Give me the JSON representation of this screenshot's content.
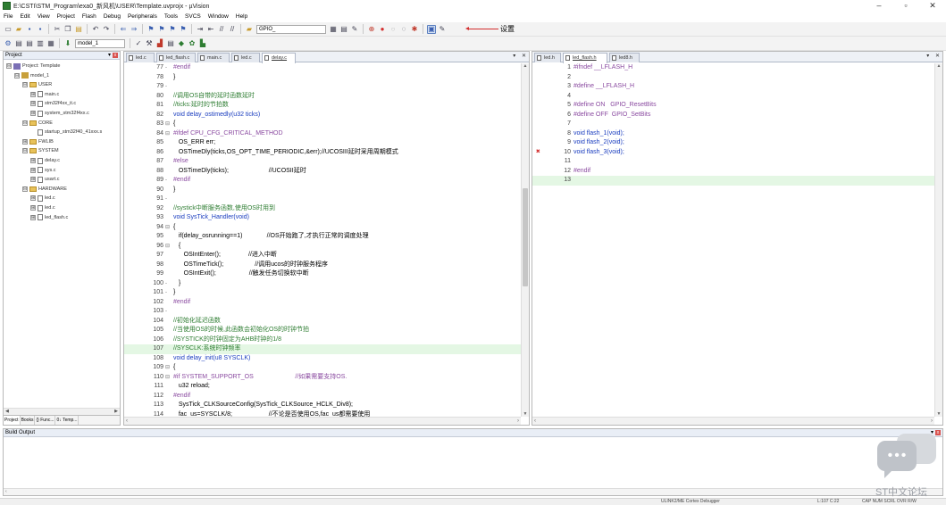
{
  "window": {
    "title": "E:\\CSTI\\STM_Program\\exa0_新风机\\USER\\Template.uvprojx - µVision",
    "controls": [
      "–",
      "▫",
      "✕"
    ]
  },
  "menu": [
    "File",
    "Edit",
    "View",
    "Project",
    "Flash",
    "Debug",
    "Peripherals",
    "Tools",
    "SVCS",
    "Window",
    "Help"
  ],
  "toolbar": {
    "search_combo": "GPIO_",
    "target_combo": "model_1",
    "annotation": "设置"
  },
  "project": {
    "title": "Project",
    "pin": "▾",
    "close": "x",
    "tree": [
      {
        "label": "Project: Template",
        "level": 0,
        "kind": "project",
        "exp": "⊟"
      },
      {
        "label": "model_1",
        "level": 1,
        "kind": "target",
        "exp": "⊟"
      },
      {
        "label": "USER",
        "level": 2,
        "kind": "folder",
        "exp": "⊟"
      },
      {
        "label": "main.c",
        "level": 3,
        "kind": "file",
        "exp": "⊞"
      },
      {
        "label": "stm32f4xx_it.c",
        "level": 3,
        "kind": "file",
        "exp": "⊞"
      },
      {
        "label": "system_stm32f4xx.c",
        "level": 3,
        "kind": "file",
        "exp": "⊞"
      },
      {
        "label": "CORE",
        "level": 2,
        "kind": "folder",
        "exp": "⊟"
      },
      {
        "label": "startup_stm32f40_41xxx.s",
        "level": 3,
        "kind": "file",
        "exp": ""
      },
      {
        "label": "FWLIB",
        "level": 2,
        "kind": "folder",
        "exp": "⊞"
      },
      {
        "label": "SYSTEM",
        "level": 2,
        "kind": "folder",
        "exp": "⊟"
      },
      {
        "label": "delay.c",
        "level": 3,
        "kind": "file",
        "exp": "⊞"
      },
      {
        "label": "sys.c",
        "level": 3,
        "kind": "file",
        "exp": "⊞"
      },
      {
        "label": "usart.c",
        "level": 3,
        "kind": "file",
        "exp": "⊞"
      },
      {
        "label": "HARDWARE",
        "level": 2,
        "kind": "folder",
        "exp": "⊟"
      },
      {
        "label": "led.c",
        "level": 3,
        "kind": "file",
        "exp": "⊞"
      },
      {
        "label": "led.c",
        "level": 3,
        "kind": "file",
        "exp": "⊞"
      },
      {
        "label": "led_flash.c",
        "level": 3,
        "kind": "file",
        "exp": "⊞"
      }
    ],
    "bottom_tabs": [
      "Project",
      "Books",
      "{} Func...",
      "0↓ Temp..."
    ]
  },
  "editor_left": {
    "tabs": [
      "led.c",
      "led_flash.c",
      "main.c",
      "led.c",
      "delay.c"
    ],
    "active_tab": 4,
    "lines": [
      {
        "n": "77",
        "f": "-",
        "t": "#endif",
        "c": "pp"
      },
      {
        "n": "78",
        "f": "",
        "t": "}",
        "c": ""
      },
      {
        "n": "79",
        "f": "-",
        "t": "",
        "c": ""
      },
      {
        "n": "80",
        "f": "",
        "t": "//调用OS自带的延时函数延时",
        "c": "cm"
      },
      {
        "n": "81",
        "f": "",
        "t": "//ticks:延时的节拍数",
        "c": "cm"
      },
      {
        "n": "82",
        "f": "",
        "t": "void delay_ostimedly(u32 ticks)",
        "c": "kw"
      },
      {
        "n": "83",
        "f": "⊟",
        "t": "{",
        "c": ""
      },
      {
        "n": "84",
        "f": "⊟",
        "t": "#ifdef CPU_CFG_CRITICAL_METHOD",
        "c": "pp"
      },
      {
        "n": "85",
        "f": "",
        "t": "   OS_ERR err;",
        "c": ""
      },
      {
        "n": "86",
        "f": "",
        "t": "   OSTimeDly(ticks,OS_OPT_TIME_PERIODIC,&err);//UCOSIII延时采用周期模式",
        "c": ""
      },
      {
        "n": "87",
        "f": "",
        "t": "#else",
        "c": "pp"
      },
      {
        "n": "88",
        "f": "",
        "t": "   OSTimeDly(ticks);                       //UCOSII延时",
        "c": ""
      },
      {
        "n": "89",
        "f": "-",
        "t": "#endif",
        "c": "pp"
      },
      {
        "n": "90",
        "f": "",
        "t": "}",
        "c": ""
      },
      {
        "n": "91",
        "f": "-",
        "t": "",
        "c": ""
      },
      {
        "n": "92",
        "f": "",
        "t": "//systick中断服务函数,使用OS时用到",
        "c": "cm"
      },
      {
        "n": "93",
        "f": "",
        "t": "void SysTick_Handler(void)",
        "c": "kw"
      },
      {
        "n": "94",
        "f": "⊟",
        "t": "{",
        "c": ""
      },
      {
        "n": "95",
        "f": "",
        "t": "   if(delay_osrunning==1)              //OS开始跑了,才执行正常的调度处理",
        "c": ""
      },
      {
        "n": "96",
        "f": "⊟",
        "t": "   {",
        "c": ""
      },
      {
        "n": "97",
        "f": "",
        "t": "      OSIntEnter();                //进入中断",
        "c": ""
      },
      {
        "n": "98",
        "f": "",
        "t": "      OSTimeTick();                  //调用ucos的时钟服务程序",
        "c": ""
      },
      {
        "n": "99",
        "f": "",
        "t": "      OSIntExit();                   //触发任务切换软中断",
        "c": ""
      },
      {
        "n": "100",
        "f": "-",
        "t": "   }",
        "c": ""
      },
      {
        "n": "101",
        "f": "-",
        "t": "}",
        "c": ""
      },
      {
        "n": "102",
        "f": "",
        "t": "#endif",
        "c": "pp"
      },
      {
        "n": "103",
        "f": "-",
        "t": "",
        "c": ""
      },
      {
        "n": "104",
        "f": "",
        "t": "//初始化延迟函数",
        "c": "cm"
      },
      {
        "n": "105",
        "f": "",
        "t": "//当使用OS的时候,此函数会初始化OS的时钟节拍",
        "c": "cm"
      },
      {
        "n": "106",
        "f": "",
        "t": "//SYSTICK的时钟固定为AHB时钟的1/8",
        "c": "cm"
      },
      {
        "n": "107",
        "f": "",
        "t": "//SYSCLK:系统时钟频率",
        "c": "cm",
        "hl": true
      },
      {
        "n": "108",
        "f": "",
        "t": "void delay_init(u8 SYSCLK)",
        "c": "kw"
      },
      {
        "n": "109",
        "f": "⊟",
        "t": "{",
        "c": ""
      },
      {
        "n": "110",
        "f": "⊟",
        "t": "#if SYSTEM_SUPPORT_OS                        //如果需要支持OS.",
        "c": "pp"
      },
      {
        "n": "111",
        "f": "",
        "t": "   u32 reload;",
        "c": ""
      },
      {
        "n": "112",
        "f": "",
        "t": "#endif",
        "c": "pp"
      },
      {
        "n": "113",
        "f": "",
        "t": "   SysTick_CLKSourceConfig(SysTick_CLKSource_HCLK_Div8);",
        "c": ""
      },
      {
        "n": "114",
        "f": "",
        "t": "   fac_us=SYSCLK/8;                     //不论是否使用OS,fac_us都需要使用",
        "c": ""
      }
    ]
  },
  "editor_right": {
    "tabs": [
      "led.h",
      "led_flash.h",
      "led8.h"
    ],
    "active_tab": 1,
    "error_line": "10",
    "lines": [
      {
        "n": "1",
        "t": "#ifndef __LFLASH_H",
        "c": "pp"
      },
      {
        "n": "2",
        "t": "",
        "c": ""
      },
      {
        "n": "3",
        "t": "#define __LFLASH_H",
        "c": "pp"
      },
      {
        "n": "4",
        "t": "",
        "c": ""
      },
      {
        "n": "5",
        "t": "#define ON   GPIO_ResetBits",
        "c": "pp"
      },
      {
        "n": "6",
        "t": "#define OFF  GPIO_SetBits",
        "c": "pp"
      },
      {
        "n": "7",
        "t": "",
        "c": ""
      },
      {
        "n": "8",
        "t": "void flash_1(void);",
        "c": "kw"
      },
      {
        "n": "9",
        "t": "void flash_2(void);",
        "c": "kw"
      },
      {
        "n": "10",
        "t": "void flash_3(void);",
        "c": "kw"
      },
      {
        "n": "11",
        "t": "",
        "c": ""
      },
      {
        "n": "12",
        "t": "#endif",
        "c": "pp"
      },
      {
        "n": "13",
        "t": "",
        "c": "",
        "hl": true
      }
    ]
  },
  "build": {
    "title": "Build Output"
  },
  "status": {
    "debugger": "ULINK2/ME Cortex Debugger",
    "position": "L:107 C:22",
    "flags": "CAP  NUM  SCRL  OVR  R/W"
  },
  "watermark": {
    "text": "ST中文论坛",
    "dots": "•••"
  }
}
